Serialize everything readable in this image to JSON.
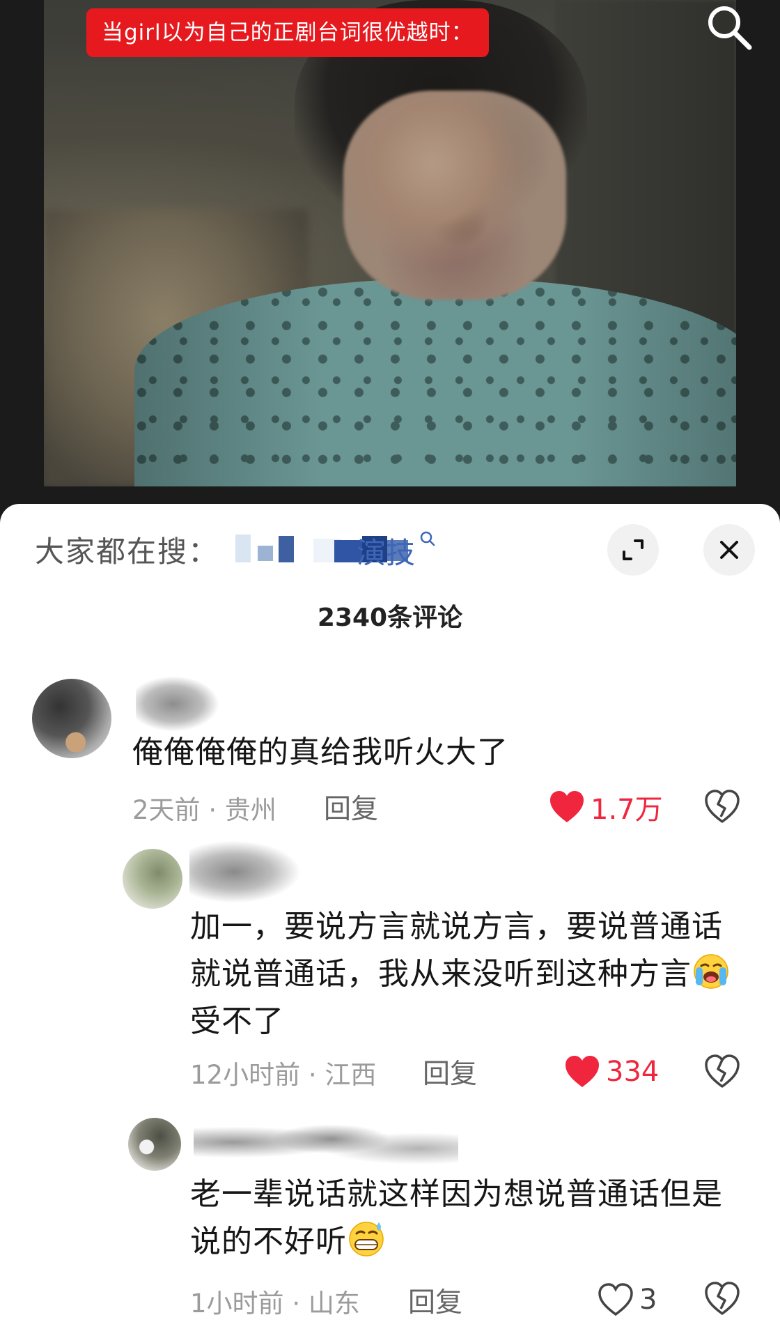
{
  "video": {
    "caption": "当girl以为自己的正剧台词很优越时："
  },
  "sheet": {
    "hot_search_label": "大家都在搜：",
    "hot_search_term_visible": "演技",
    "comment_count": "2340条评论"
  },
  "comments": [
    {
      "text": "俺俺俺俺的真给我听火大了",
      "time": "2天前",
      "location": "贵州",
      "reply_label": "回复",
      "likes": "1.7万",
      "liked": true
    },
    {
      "text_before_emoji": "加一，要说方言就说方言，要说普通话就说普通话，我从来没听到这种方言",
      "emoji": "loudly-crying-face",
      "text_after_emoji": "受不了",
      "time": "12小时前",
      "location": "江西",
      "reply_label": "回复",
      "likes": "334",
      "liked": true
    },
    {
      "text_before_emoji": "老一辈说话就这样因为想说普通话但是说的不好听",
      "emoji": "grinning-sweat-face",
      "time": "1小时前",
      "location": "山东",
      "reply_label": "回复",
      "likes": "3",
      "liked": false
    }
  ],
  "colors": {
    "caption_bg": "#e5191e",
    "like_red": "#f0263f",
    "link_blue": "#3d66b8",
    "meta_gray": "#9b9b9b"
  },
  "icons": {
    "search": "search-icon",
    "expand": "expand-icon",
    "close": "close-icon",
    "like": "heart-icon",
    "dislike": "broken-heart-icon"
  }
}
